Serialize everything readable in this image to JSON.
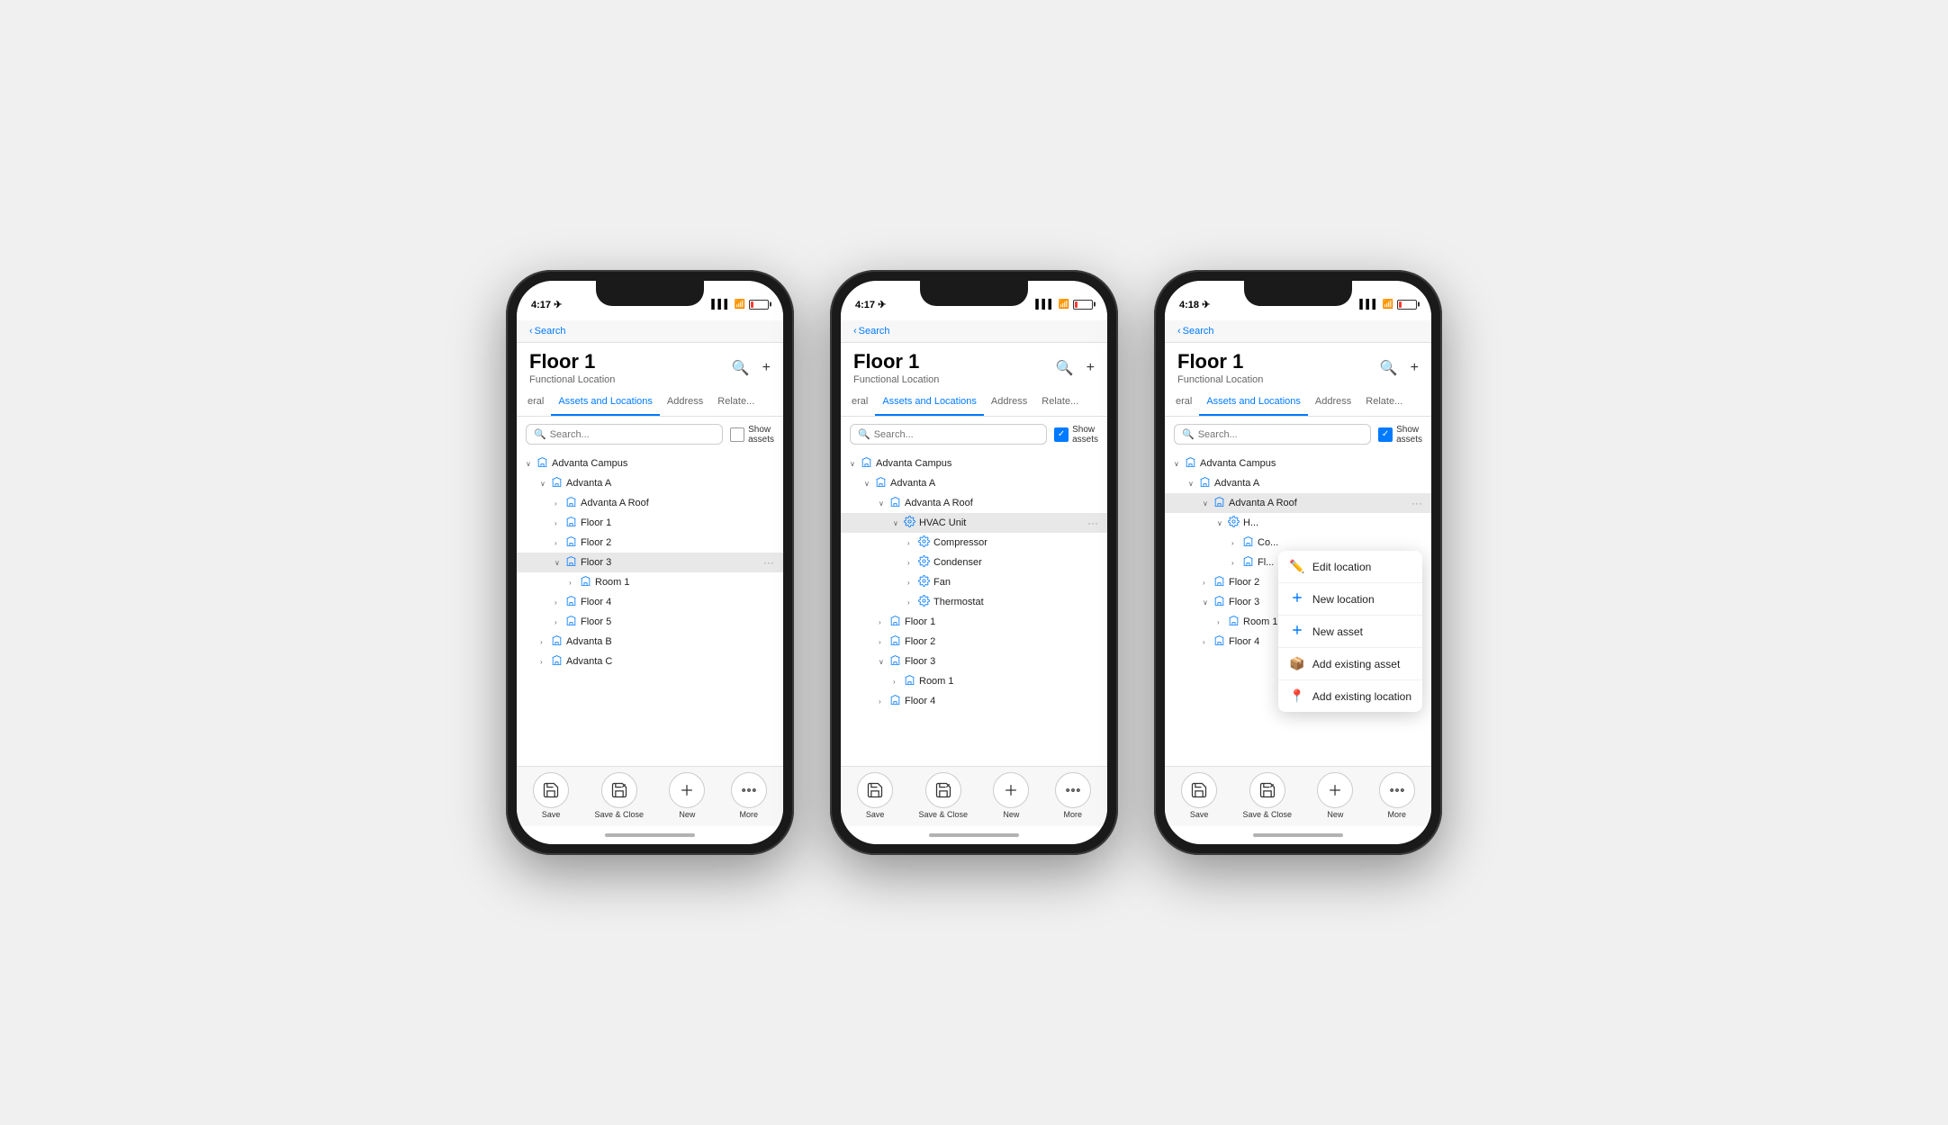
{
  "phones": [
    {
      "id": "phone1",
      "time": "4:17",
      "back_label": "Search",
      "title": "Floor 1",
      "subtitle": "Functional Location",
      "tabs": [
        "eral",
        "Assets and Locations",
        "Address",
        "Relate..."
      ],
      "active_tab": 1,
      "search_placeholder": "Search...",
      "show_assets": false,
      "tree": [
        {
          "indent": 0,
          "expand": true,
          "icon": "loc",
          "label": "Advanta Campus",
          "asset": false
        },
        {
          "indent": 1,
          "expand": true,
          "icon": "loc",
          "label": "Advanta A",
          "asset": false
        },
        {
          "indent": 2,
          "expand": false,
          "icon": "loc",
          "label": "Advanta A Roof",
          "asset": false
        },
        {
          "indent": 2,
          "expand": false,
          "icon": "loc",
          "label": "Floor 1",
          "asset": false
        },
        {
          "indent": 2,
          "expand": false,
          "icon": "loc",
          "label": "Floor 2",
          "asset": false
        },
        {
          "indent": 2,
          "expand": true,
          "icon": "loc",
          "label": "Floor 3",
          "asset": false,
          "highlighted": true,
          "more": true
        },
        {
          "indent": 3,
          "expand": false,
          "icon": "loc",
          "label": "Room 1",
          "asset": false
        },
        {
          "indent": 2,
          "expand": false,
          "icon": "loc",
          "label": "Floor 4",
          "asset": false
        },
        {
          "indent": 2,
          "expand": false,
          "icon": "loc",
          "label": "Floor 5",
          "asset": false
        },
        {
          "indent": 1,
          "expand": false,
          "icon": "loc",
          "label": "Advanta B",
          "asset": false
        },
        {
          "indent": 1,
          "expand": false,
          "icon": "loc",
          "label": "Advanta C",
          "asset": false
        }
      ],
      "bottom": [
        "Save",
        "Save & Close",
        "New",
        "More"
      ],
      "dropdown": null
    },
    {
      "id": "phone2",
      "time": "4:17",
      "back_label": "Search",
      "title": "Floor 1",
      "subtitle": "Functional Location",
      "tabs": [
        "eral",
        "Assets and Locations",
        "Address",
        "Relate..."
      ],
      "active_tab": 1,
      "search_placeholder": "Search...",
      "show_assets": true,
      "tree": [
        {
          "indent": 0,
          "expand": true,
          "icon": "loc",
          "label": "Advanta Campus",
          "asset": false
        },
        {
          "indent": 1,
          "expand": true,
          "icon": "loc",
          "label": "Advanta A",
          "asset": false
        },
        {
          "indent": 2,
          "expand": true,
          "icon": "loc",
          "label": "Advanta A Roof",
          "asset": false
        },
        {
          "indent": 3,
          "expand": true,
          "icon": "asset",
          "label": "HVAC Unit",
          "asset": true,
          "highlighted": true,
          "more": true
        },
        {
          "indent": 4,
          "expand": false,
          "icon": "asset",
          "label": "Compressor",
          "asset": true
        },
        {
          "indent": 4,
          "expand": false,
          "icon": "asset",
          "label": "Condenser",
          "asset": true
        },
        {
          "indent": 4,
          "expand": false,
          "icon": "asset",
          "label": "Fan",
          "asset": true
        },
        {
          "indent": 4,
          "expand": false,
          "icon": "asset",
          "label": "Thermostat",
          "asset": true
        },
        {
          "indent": 2,
          "expand": false,
          "icon": "loc",
          "label": "Floor 1",
          "asset": false
        },
        {
          "indent": 2,
          "expand": false,
          "icon": "loc",
          "label": "Floor 2",
          "asset": false
        },
        {
          "indent": 2,
          "expand": true,
          "icon": "loc",
          "label": "Floor 3",
          "asset": false
        },
        {
          "indent": 3,
          "expand": false,
          "icon": "loc",
          "label": "Room 1",
          "asset": false
        },
        {
          "indent": 2,
          "expand": false,
          "icon": "loc",
          "label": "Floor 4",
          "asset": false
        }
      ],
      "bottom": [
        "Save",
        "Save & Close",
        "New",
        "More"
      ],
      "dropdown": null
    },
    {
      "id": "phone3",
      "time": "4:18",
      "back_label": "Search",
      "title": "Floor 1",
      "subtitle": "Functional Location",
      "tabs": [
        "eral",
        "Assets and Locations",
        "Address",
        "Relate..."
      ],
      "active_tab": 1,
      "search_placeholder": "Search...",
      "show_assets": true,
      "tree": [
        {
          "indent": 0,
          "expand": true,
          "icon": "loc",
          "label": "Advanta Campus",
          "asset": false
        },
        {
          "indent": 1,
          "expand": true,
          "icon": "loc",
          "label": "Advanta A",
          "asset": false
        },
        {
          "indent": 2,
          "expand": true,
          "icon": "loc",
          "label": "Advanta A Roof",
          "asset": false,
          "highlighted": true,
          "more": true
        },
        {
          "indent": 3,
          "expand": true,
          "icon": "asset",
          "label": "H...",
          "asset": true
        },
        {
          "indent": 4,
          "expand": false,
          "icon": "loc",
          "label": "Co...",
          "asset": false
        },
        {
          "indent": 4,
          "expand": false,
          "icon": "loc",
          "label": "Fl...",
          "asset": false
        },
        {
          "indent": 2,
          "expand": false,
          "icon": "loc",
          "label": "Floor 2",
          "asset": false
        },
        {
          "indent": 2,
          "expand": true,
          "icon": "loc",
          "label": "Floor 3",
          "asset": false
        },
        {
          "indent": 3,
          "expand": false,
          "icon": "loc",
          "label": "Room 1",
          "asset": false
        },
        {
          "indent": 2,
          "expand": false,
          "icon": "loc",
          "label": "Floor 4",
          "asset": false
        }
      ],
      "bottom": [
        "Save",
        "Save & Close",
        "New",
        "More"
      ],
      "dropdown": {
        "items": [
          {
            "icon": "edit",
            "label": "Edit location"
          },
          {
            "icon": "new-loc",
            "label": "New location"
          },
          {
            "icon": "new-asset",
            "label": "New asset"
          },
          {
            "icon": "add-asset",
            "label": "Add existing asset"
          },
          {
            "icon": "add-loc",
            "label": "Add existing location"
          }
        ]
      }
    }
  ]
}
